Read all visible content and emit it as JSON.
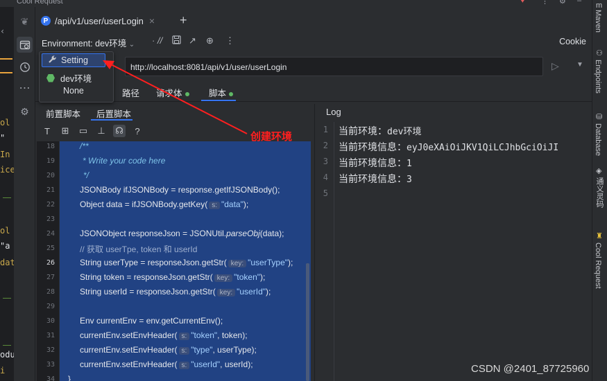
{
  "window": {
    "title": "Cool Request"
  },
  "tab": {
    "badge": "P",
    "label": "/api/v1/user/userLogin",
    "add": "+"
  },
  "toolbar": {
    "env_label": "Environment: dev环境",
    "cookie": "Cookie"
  },
  "url": {
    "value": "http://localhost:8081/api/v1/user/userLogin"
  },
  "request_tabs": [
    {
      "label": "路径"
    },
    {
      "label": "请求体"
    },
    {
      "label": "脚本"
    }
  ],
  "dropdown": {
    "setting": "Setting",
    "dev": "dev环境",
    "none": "None"
  },
  "script_tabs": [
    {
      "label": "前置脚本"
    },
    {
      "label": "后置脚本"
    }
  ],
  "editor_tools": {
    "help": "?"
  },
  "code": {
    "line_numbers": [
      "18",
      "19",
      "20",
      "21",
      "22",
      "23",
      "24",
      "25",
      "26",
      "27",
      "28",
      "29",
      "30",
      "31",
      "32",
      "33",
      "34"
    ],
    "l18": "/**",
    "l19": "* Write your code here",
    "l20": "*/",
    "l21": "JSONBody ifJSONBody = response.getIfJSONBody();",
    "l22a": "Object data = ifJSONBody.getKey(",
    "l22h": "s:",
    "l22s": "\"data\"",
    "l22b": ");",
    "l24a": "JSONObject responseJson = JSONUtil.",
    "l24i": "parseObj",
    "l24b": "(data);",
    "l25": "// 获取 userTpe, token 和 userId",
    "l26a": "String userType = responseJson.getStr(",
    "l26h": "key:",
    "l26s": "\"userType\"",
    "l26b": ");",
    "l27a": "String token = responseJson.getStr(",
    "l27h": "key:",
    "l27s": "\"token\"",
    "l27b": ");",
    "l28a": "String userId = responseJson.getStr(",
    "l28h": "key:",
    "l28s": "\"userId\"",
    "l28b": ");",
    "l30": "Env currentEnv = env.getCurrentEnv();",
    "l31a": "currentEnv.setEnvHeader(",
    "l31h": "s:",
    "l31s": "\"token\"",
    "l31b": ", token);",
    "l32a": "currentEnv.setEnvHeader(",
    "l32h": "s:",
    "l32s": "\"type\"",
    "l32b": ", userType);",
    "l33a": "currentEnv.setEnvHeader(",
    "l33h": "s:",
    "l33s": "\"userId\"",
    "l33b": ", userId);",
    "l34": "}"
  },
  "log": {
    "title": "Log",
    "line_numbers": [
      "1",
      "2",
      "3",
      "4",
      "5"
    ],
    "l1a": "当前环境：",
    "l1b": "dev环境",
    "l2a": "当前环境信息：",
    "l2b": "eyJ0eXAiOiJKV1QiLCJhbGciOiJI",
    "l3a": "当前环境信息：",
    "l3b": "1",
    "l4a": "当前环境信息：",
    "l4b": "3"
  },
  "right_strip": [
    "Maven",
    "Endpoints",
    "Database",
    "通义灵码",
    "Cool Request"
  ],
  "annotation": {
    "text": "创建环境",
    "color": "#ff1f1f"
  },
  "watermark": "CSDN @2401_87725960",
  "colors": {
    "accent": "#3574f0",
    "selection": "#214283",
    "ok": "#5fb865"
  }
}
